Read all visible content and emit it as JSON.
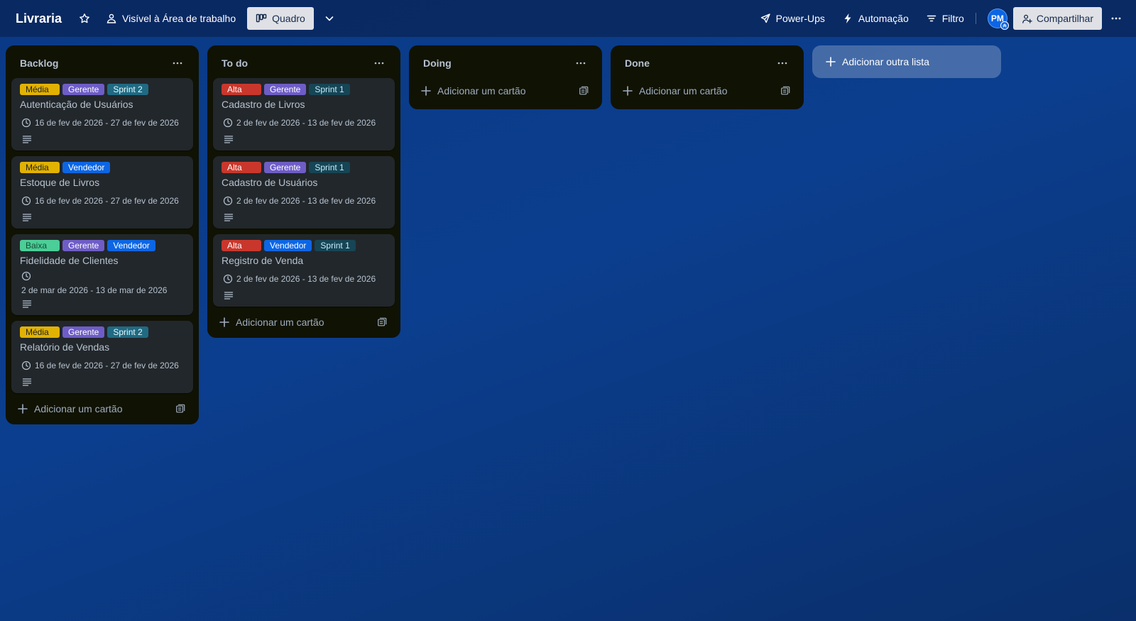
{
  "header": {
    "board_title": "Livraria",
    "visibility_label": "Visível à Área de trabalho",
    "view_label": "Quadro",
    "powerups_label": "Power-Ups",
    "automation_label": "Automação",
    "filter_label": "Filtro",
    "avatar_initials": "PM",
    "share_label": "Compartilhar"
  },
  "lists": [
    {
      "title": "Backlog",
      "add_card_label": "Adicionar um cartão",
      "cards": [
        {
          "labels": [
            {
              "text": "Média",
              "color": "yellow"
            },
            {
              "text": "Gerente",
              "color": "purple"
            },
            {
              "text": "Sprint 2",
              "color": "teal"
            }
          ],
          "title": "Autenticação de Usuários",
          "due": "16 de fev de 2026 - 27 de fev de 2026"
        },
        {
          "labels": [
            {
              "text": "Média",
              "color": "yellow"
            },
            {
              "text": "Vendedor",
              "color": "blue"
            }
          ],
          "title": "Estoque de Livros",
          "due": "16 de fev de 2026 - 27 de fev de 2026"
        },
        {
          "labels": [
            {
              "text": "Baixa",
              "color": "green"
            },
            {
              "text": "Gerente",
              "color": "purple"
            },
            {
              "text": "Vendedor",
              "color": "blue"
            }
          ],
          "title": "Fidelidade de Clientes",
          "due": "2 de mar de 2026 - 13 de mar de 2026"
        },
        {
          "labels": [
            {
              "text": "Média",
              "color": "yellow"
            },
            {
              "text": "Gerente",
              "color": "purple"
            },
            {
              "text": "Sprint 2",
              "color": "teal"
            }
          ],
          "title": "Relatório de Vendas",
          "due": "16 de fev de 2026 - 27 de fev de 2026"
        }
      ]
    },
    {
      "title": "To do",
      "add_card_label": "Adicionar um cartão",
      "cards": [
        {
          "labels": [
            {
              "text": "Alta",
              "color": "red"
            },
            {
              "text": "Gerente",
              "color": "purple"
            },
            {
              "text": "Sprint 1",
              "color": "darkteal"
            }
          ],
          "title": "Cadastro de Livros",
          "due": "2 de fev de 2026 - 13 de fev de 2026"
        },
        {
          "labels": [
            {
              "text": "Alta",
              "color": "red"
            },
            {
              "text": "Gerente",
              "color": "purple"
            },
            {
              "text": "Sprint 1",
              "color": "darkteal"
            }
          ],
          "title": "Cadastro de Usuários",
          "due": "2 de fev de 2026 - 13 de fev de 2026"
        },
        {
          "labels": [
            {
              "text": "Alta",
              "color": "red"
            },
            {
              "text": "Vendedor",
              "color": "blue"
            },
            {
              "text": "Sprint 1",
              "color": "darkteal"
            }
          ],
          "title": "Registro de Venda",
          "due": "2 de fev de 2026 - 13 de fev de 2026"
        }
      ]
    },
    {
      "title": "Doing",
      "add_card_label": "Adicionar um cartão",
      "cards": []
    },
    {
      "title": "Done",
      "add_card_label": "Adicionar um cartão",
      "cards": []
    }
  ],
  "add_list_label": "Adicionar outra lista",
  "colors": {
    "label_yellow": "#e2b203",
    "label_red": "#c9372c",
    "label_green": "#4bce97",
    "label_purple": "#6e5dc6",
    "label_blue": "#0c66e4",
    "label_teal": "#206a83",
    "list_background": "#101204",
    "card_background": "#22272b"
  }
}
